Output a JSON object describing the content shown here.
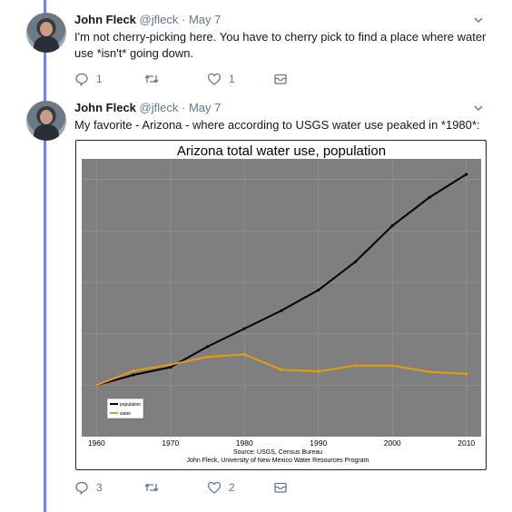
{
  "tweets": [
    {
      "author_name": "John Fleck",
      "author_handle": "@jfleck",
      "date": "May 7",
      "text": "I'm not cherry-picking here. You have to cherry pick to find a place where water use *isn't* going down.",
      "actions": {
        "replies": "1",
        "retweets": "",
        "likes": "1"
      }
    },
    {
      "author_name": "John Fleck",
      "author_handle": "@jfleck",
      "date": "May 7",
      "text": "My favorite - Arizona - where according to USGS water use peaked in *1980*:",
      "actions": {
        "replies": "3",
        "retweets": "",
        "likes": "2"
      }
    }
  ],
  "chart_data": {
    "type": "line",
    "title": "Arizona total water use, population",
    "x": [
      1960,
      1965,
      1970,
      1975,
      1980,
      1985,
      1990,
      1995,
      2000,
      2005,
      2010
    ],
    "xticks": [
      "1960",
      "1970",
      "1980",
      "1990",
      "2000",
      "2010"
    ],
    "xlim": [
      1958,
      2012
    ],
    "series": [
      {
        "name": "population",
        "color": "#000000",
        "values": [
          1.0,
          1.2,
          1.35,
          1.75,
          2.1,
          2.45,
          2.85,
          3.4,
          4.1,
          4.65,
          5.1
        ]
      },
      {
        "name": "water",
        "color": "#e69b0f",
        "values": [
          1.0,
          1.28,
          1.4,
          1.55,
          1.6,
          1.3,
          1.27,
          1.38,
          1.38,
          1.26,
          1.22
        ]
      }
    ],
    "ylim": [
      0.0,
      5.4
    ],
    "grid": true,
    "legend_position": "bottom-left",
    "footer_lines": [
      "Source: USGS, Census Bureau",
      "John Fleck, University of New Mexico Water Resources Program"
    ]
  },
  "colors": {
    "thread": "#7a7fe8",
    "panel": "#7f7f7f",
    "grid": "#8f8f8f",
    "secondary_text": "#657786"
  },
  "icons": [
    "chevron-down-icon",
    "reply-icon",
    "retweet-icon",
    "like-icon",
    "message-icon"
  ]
}
